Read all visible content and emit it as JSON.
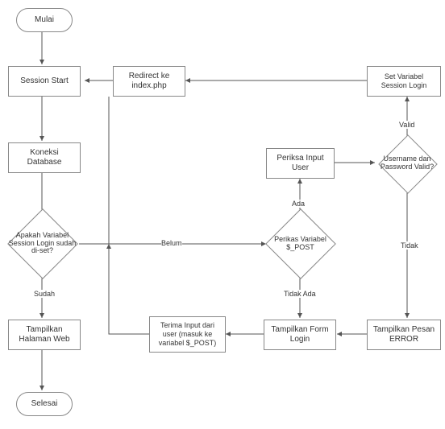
{
  "nodes": {
    "start": "Mulai",
    "session_start": "Session Start",
    "redirect": "Redirect ke index.php",
    "set_var": "Set Variabel Session Login",
    "db": "Koneksi Database",
    "periksa_user": "Periksa Input User",
    "dec_valid": "Username dan Password Valid?",
    "dec_session": "Apakah Variabel Session Login sudah di-set?",
    "dec_post": "Perikas Variabel $_POST",
    "tampil_web": "Tampilkan Halaman Web",
    "terima_input": "Terima Input dari user (masuk ke variabel $_POST)",
    "form_login": "Tampilkan Form Login",
    "pesan_error": "Tampilkan Pesan\nERROR",
    "end": "Selesai"
  },
  "edges": {
    "valid": "Valid",
    "tidak": "Tidak",
    "belum": "Belum",
    "sudah": "Sudah",
    "ada": "Ada",
    "tidak_ada": "Tidak Ada"
  }
}
